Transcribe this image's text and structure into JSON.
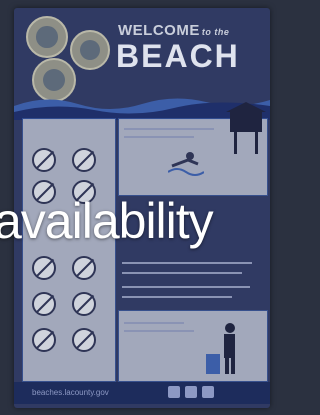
{
  "sign": {
    "welcome": "WELCOME",
    "to_the": "to the",
    "beach": "BEACH",
    "footer_url": "beaches.lacounty.gov"
  },
  "overlay": {
    "text": "availability",
    "color": "#ffffff"
  },
  "colors": {
    "sign_background": "#303a63",
    "accent_blue": "#3c5ea8"
  }
}
